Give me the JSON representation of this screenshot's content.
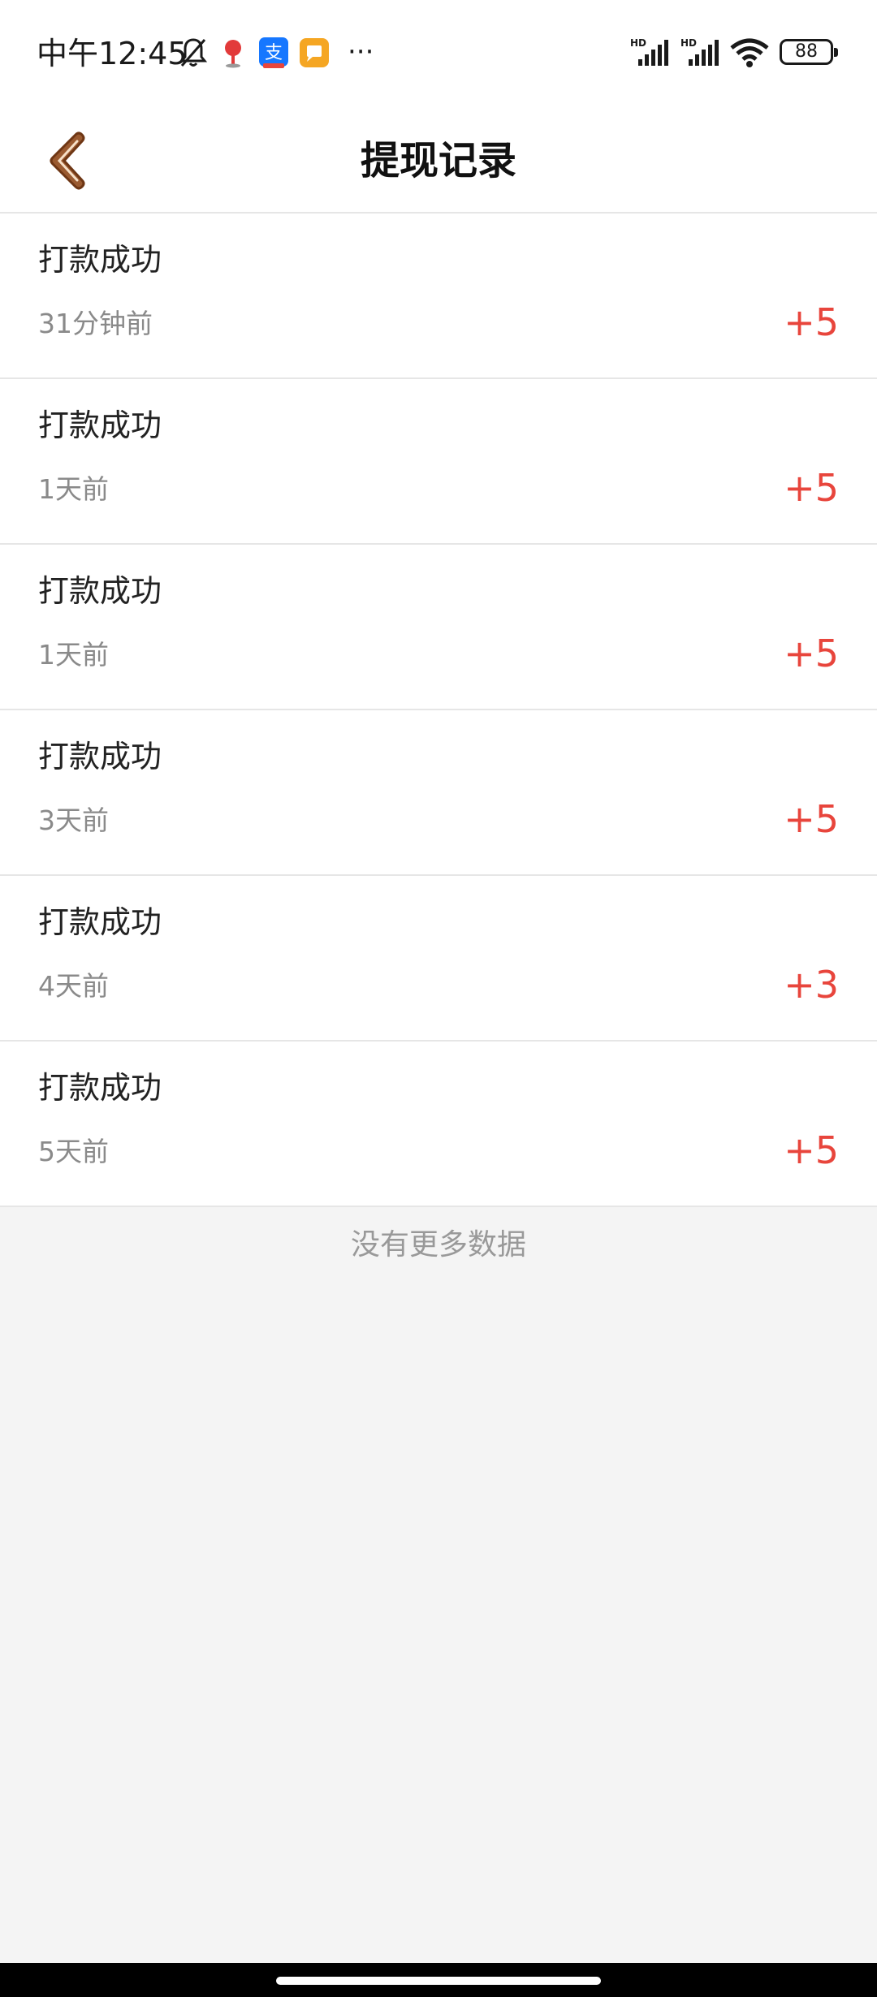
{
  "status_bar": {
    "time": "中午12:45",
    "more_indicator": "···",
    "battery": "88",
    "icons": [
      "bell-muted-icon",
      "map-pin-icon",
      "alipay-icon",
      "message-app-icon",
      "signal-hd-icon",
      "signal-hd-icon",
      "wifi-icon",
      "battery-icon"
    ]
  },
  "nav": {
    "title": "提现记录",
    "back_icon": "chevron-left-icon"
  },
  "records": [
    {
      "status": "打款成功",
      "time": "31分钟前",
      "amount": "+5"
    },
    {
      "status": "打款成功",
      "time": "1天前",
      "amount": "+5"
    },
    {
      "status": "打款成功",
      "time": "1天前",
      "amount": "+5"
    },
    {
      "status": "打款成功",
      "time": "3天前",
      "amount": "+5"
    },
    {
      "status": "打款成功",
      "time": "4天前",
      "amount": "+3"
    },
    {
      "status": "打款成功",
      "time": "5天前",
      "amount": "+5"
    }
  ],
  "footer": {
    "no_more": "没有更多数据"
  },
  "colors": {
    "amount": "#e8453c",
    "background": "#f4f4f4",
    "card": "#ffffff",
    "back_icon": "#8b4a22"
  }
}
